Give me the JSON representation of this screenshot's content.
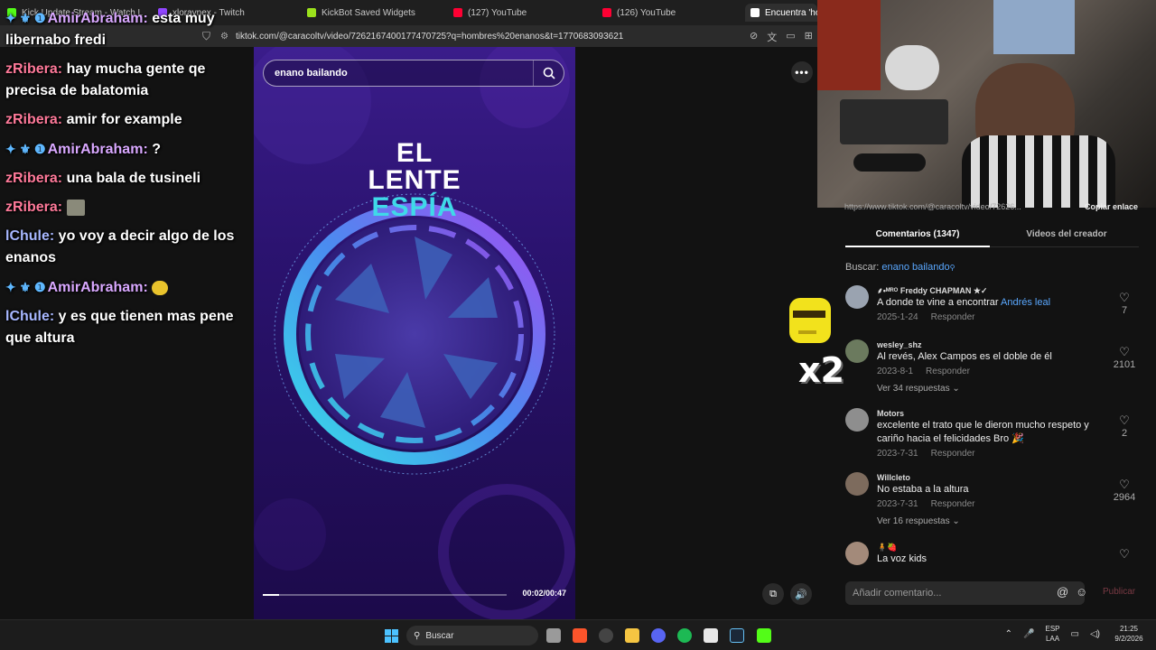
{
  "browser": {
    "tabs": [
      {
        "title": "Kick Update Stream - Watch Live",
        "favicon_color": "#53fc18"
      },
      {
        "title": "xloraynex - Twitch",
        "favicon_color": "#9146ff"
      },
      {
        "title": "KickBot Saved Widgets",
        "favicon_color": "#9be11c"
      },
      {
        "title": "(127) YouTube",
        "favicon_color": "#ff0033"
      },
      {
        "title": "(126) YouTube",
        "favicon_color": "#ff0033"
      },
      {
        "title": "Encuentra 'ho",
        "favicon_color": "#ffffff"
      }
    ],
    "url": "tiktok.com/@caracoltv/video/7262167400177470725?q=hombres%20enanos&t=1770683093621"
  },
  "chat": [
    {
      "badges": "✦ ⚜ ❶",
      "user": "AmirAbraham",
      "user_class": "u-amir",
      "text": "esta muy libernabo fredi"
    },
    {
      "badges": "",
      "user": "zRibera",
      "user_class": "u-ribera",
      "text": "hay mucha gente qe precisa de balatomia"
    },
    {
      "badges": "",
      "user": "zRibera",
      "user_class": "u-ribera",
      "text": "amir for example"
    },
    {
      "badges": "✦ ⚜ ❶",
      "user": "AmirAbraham",
      "user_class": "u-amir",
      "text": "?"
    },
    {
      "badges": "",
      "user": "zRibera",
      "user_class": "u-ribera",
      "text": "una bala de tusineli"
    },
    {
      "badges": "",
      "user": "zRibera",
      "user_class": "u-ribera",
      "text": "",
      "emote": "thumb"
    },
    {
      "badges": "",
      "user": "lChule",
      "user_class": "u-chule",
      "text": "yo voy a decir algo de los enanos"
    },
    {
      "badges": "✦ ⚜ ❶",
      "user": "AmirAbraham",
      "user_class": "u-amir",
      "text": "",
      "emote": "emoji"
    },
    {
      "badges": "",
      "user": "lChule",
      "user_class": "u-chule",
      "text": "y es que tienen mas pene que altura"
    }
  ],
  "video": {
    "search_text": "enano bailando",
    "logo_line1": "EL",
    "logo_line2": "LENTE",
    "logo_line3": "ESPÍA",
    "time": "00:02/00:47",
    "progress_fraction": 0.065
  },
  "panel": {
    "url_fragment": "https://www.tiktok.com/@caracoltv/video/72626...",
    "copy_link": "Copiar enlace",
    "tab_comments": "Comentarios (1347)",
    "tab_videos": "Videos del creador",
    "buscar_label": "Buscar:",
    "buscar_query": "enano bailando",
    "comments": [
      {
        "user": "⸙•ᴹᴿᴼ Freddy CHAPMAN ★✓",
        "text_before": "A donde te vine a encontrar ",
        "highlight": "Andrés leal",
        "date": "2025-1-24",
        "reply": "Responder",
        "likes": "7",
        "replies": "",
        "avatar": "#9aa3b0"
      },
      {
        "user": "wesley_shz",
        "text_before": "Al revés, Alex Campos es el doble de él",
        "highlight": "",
        "date": "2023-8-1",
        "reply": "Responder",
        "likes": "2101",
        "replies": "Ver 34 respuestas ⌄",
        "avatar": "#6b7a5e"
      },
      {
        "user": "Motors",
        "text_before": "excelente el trato que le dieron mucho respeto y cariño hacia el felicidades Bro 🎉",
        "highlight": "",
        "date": "2023-7-31",
        "reply": "Responder",
        "likes": "2",
        "replies": "",
        "avatar": "#8e8e8e"
      },
      {
        "user": "Willcleto",
        "text_before": "No estaba a la altura",
        "highlight": "",
        "date": "2023-7-31",
        "reply": "Responder",
        "likes": "2964",
        "replies": "Ver 16 respuestas ⌄",
        "avatar": "#7d6b5d"
      },
      {
        "user": "🧍🍓",
        "text_before": "La voz kids",
        "highlight": "",
        "date": "",
        "reply": "",
        "likes": "",
        "replies": "",
        "avatar": "#a38a7a"
      }
    ],
    "input_placeholder": "Añadir comentario...",
    "publish": "Publicar"
  },
  "overlay": {
    "multiplier": "x2"
  },
  "taskbar": {
    "search_label": "Buscar",
    "lang_top": "ESP",
    "lang_bottom": "LAA",
    "time": "21:25",
    "date": "9/2/2026"
  }
}
